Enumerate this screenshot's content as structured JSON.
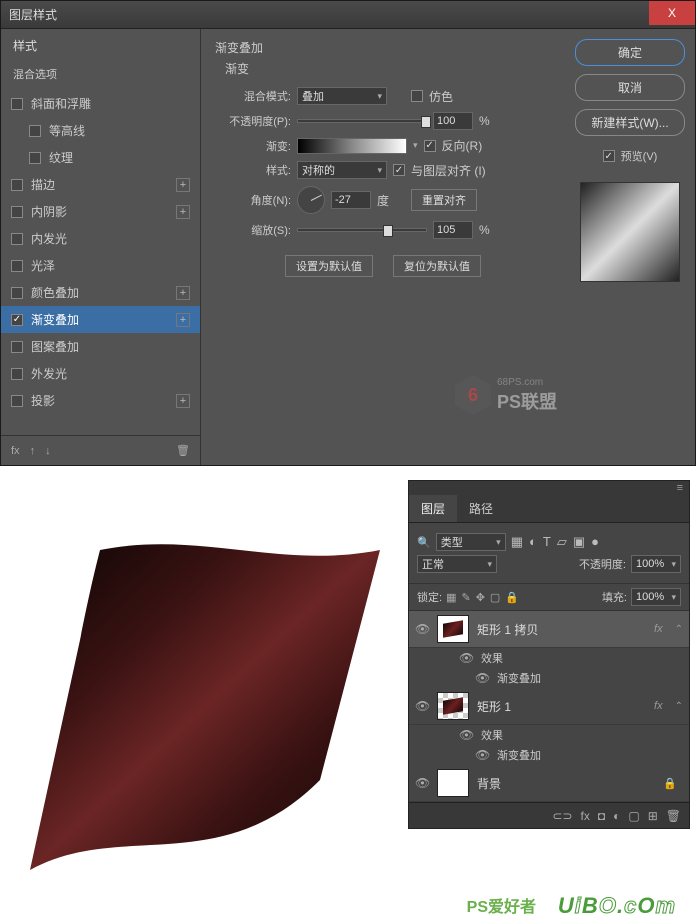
{
  "dialog": {
    "title": "图层样式",
    "close": "X",
    "styles_header": "样式",
    "blend_options": "混合选项",
    "styles": [
      {
        "label": "斜面和浮雕",
        "checked": false,
        "plus": false
      },
      {
        "label": "等高线",
        "checked": false,
        "plus": false,
        "indent": true
      },
      {
        "label": "纹理",
        "checked": false,
        "plus": false,
        "indent": true
      },
      {
        "label": "描边",
        "checked": false,
        "plus": true
      },
      {
        "label": "内阴影",
        "checked": false,
        "plus": true
      },
      {
        "label": "内发光",
        "checked": false,
        "plus": false
      },
      {
        "label": "光泽",
        "checked": false,
        "plus": false
      },
      {
        "label": "颜色叠加",
        "checked": false,
        "plus": true
      },
      {
        "label": "渐变叠加",
        "checked": true,
        "plus": true,
        "selected": true
      },
      {
        "label": "图案叠加",
        "checked": false,
        "plus": false
      },
      {
        "label": "外发光",
        "checked": false,
        "plus": false
      },
      {
        "label": "投影",
        "checked": false,
        "plus": true
      }
    ],
    "footer": {
      "fx": "fx",
      "trash": "🗑"
    },
    "settings": {
      "group_title": "渐变叠加",
      "sub_title": "渐变",
      "blend_mode_label": "混合模式:",
      "blend_mode_value": "叠加",
      "dither_label": "仿色",
      "opacity_label": "不透明度(P):",
      "opacity_value": "100",
      "percent": "%",
      "gradient_label": "渐变:",
      "reverse_label": "反向(R)",
      "style_label": "样式:",
      "style_value": "对称的",
      "align_label": "与图层对齐 (I)",
      "angle_label": "角度(N):",
      "angle_value": "-27",
      "degree": "度",
      "reset_align": "重置对齐",
      "scale_label": "缩放(S):",
      "scale_value": "105",
      "set_default": "设置为默认值",
      "reset_default": "复位为默认值"
    },
    "right": {
      "ok": "确定",
      "cancel": "取消",
      "new_style": "新建样式(W)...",
      "preview": "预览(V)"
    },
    "watermark": {
      "small": "68PS.com",
      "big": "PS联盟"
    }
  },
  "layers_panel": {
    "tab1": "图层",
    "tab2": "路径",
    "kind_label": "类型",
    "blend_mode": "正常",
    "opacity_label": "不透明度:",
    "opacity_value": "100%",
    "lock_label": "锁定:",
    "fill_label": "填充:",
    "fill_value": "100%",
    "layers": [
      {
        "name": "矩形 1 拷贝",
        "selected": true,
        "fx": true,
        "thumb": "shape"
      },
      {
        "name": "矩形 1",
        "selected": false,
        "fx": true,
        "thumb": "shape-checker"
      },
      {
        "name": "背景",
        "selected": false,
        "locked": true,
        "thumb": "white"
      }
    ],
    "effects_label": "效果",
    "gradient_overlay_label": "渐变叠加"
  },
  "watermark_bottom": "UiBO.cOm",
  "watermark_ps2": "PS爱好者"
}
